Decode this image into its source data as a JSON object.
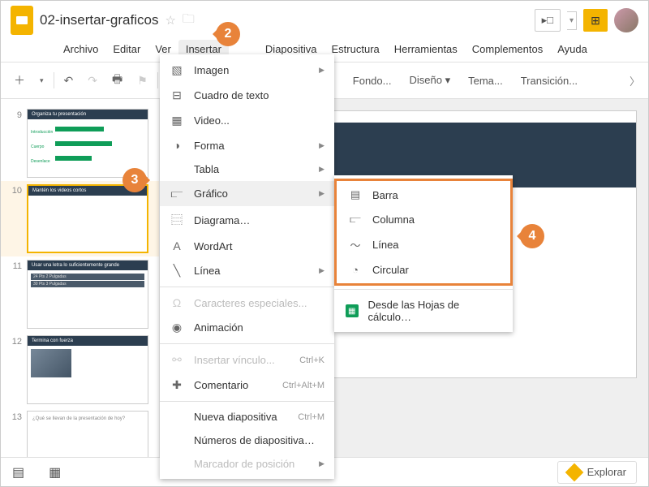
{
  "title": "02-insertar-graficos",
  "menu": [
    "Archivo",
    "Editar",
    "Ver",
    "Insertar",
    "",
    "",
    "Diapositiva",
    "Estructura",
    "Herramientas",
    "Complementos",
    "Ayuda"
  ],
  "toolbar": {
    "fondo": "Fondo...",
    "diseno": "Diseño ▾",
    "tema": "Tema...",
    "trans": "Transición..."
  },
  "thumbs": {
    "t9": {
      "num": "9",
      "title": "Organiza tu presentación",
      "l1": "Introducción",
      "l2": "Cuerpo",
      "l3": "Desenlace"
    },
    "t10": {
      "num": "10",
      "title": "Mantén los videos cortos"
    },
    "t11": {
      "num": "11",
      "title": "Usar una letra lo suficientemente grande",
      "r1": "24 Pts    2 Pulgadas",
      "r2": "30 Pts    3 Pulgadas"
    },
    "t12": {
      "num": "12",
      "title": "Termina con fuerza"
    },
    "t13": {
      "num": "13",
      "text": "¿Qué se llevan de la presentación de hoy?"
    }
  },
  "insert_menu": {
    "imagen": "Imagen",
    "cuadro": "Cuadro de texto",
    "video": "Video...",
    "forma": "Forma",
    "tabla": "Tabla",
    "grafico": "Gráfico",
    "diagrama": "Diagrama…",
    "wordart": "WordArt",
    "linea": "Línea",
    "caracteres": "Caracteres especiales...",
    "animacion": "Animación",
    "vinculo": "Insertar vínculo...",
    "vinculo_k": "Ctrl+K",
    "comentario": "Comentario",
    "comentario_k": "Ctrl+Alt+M",
    "nueva": "Nueva diapositiva",
    "nueva_k": "Ctrl+M",
    "numeros": "Números de diapositiva…",
    "marcador": "Marcador de posición"
  },
  "chart_submenu": {
    "barra": "Barra",
    "columna": "Columna",
    "linea": "Línea",
    "circular": "Circular",
    "sheets": "Desde las Hojas de cálculo…"
  },
  "callouts": {
    "c2": "2",
    "c3": "3",
    "c4": "4"
  },
  "explore": "Explorar"
}
